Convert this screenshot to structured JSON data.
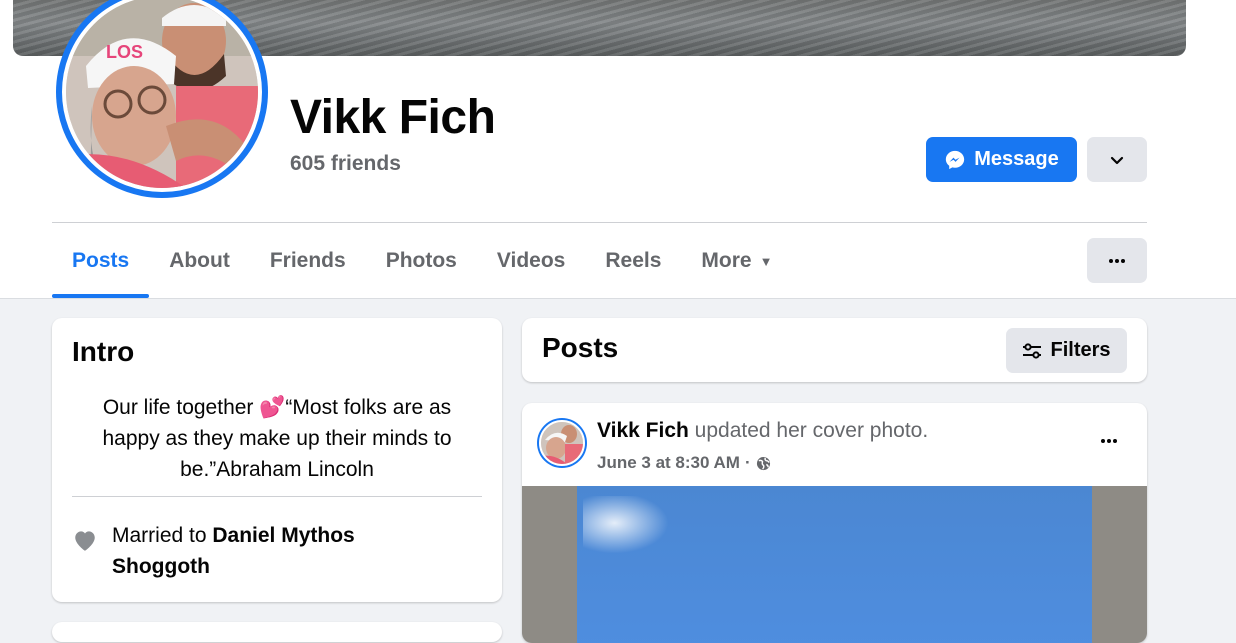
{
  "profile": {
    "name": "Vikk Fich",
    "friends": "605 friends"
  },
  "actions": {
    "message_label": "Message"
  },
  "tabs": [
    {
      "label": "Posts",
      "active": true
    },
    {
      "label": "About"
    },
    {
      "label": "Friends"
    },
    {
      "label": "Photos"
    },
    {
      "label": "Videos"
    },
    {
      "label": "Reels"
    },
    {
      "label": "More"
    }
  ],
  "intro": {
    "title": "Intro",
    "bio_before": "Our life together ",
    "bio_emoji": "💕",
    "bio_after": "“Most folks are as happy as they make up their minds to be.”Abraham Lincoln",
    "relationship_prefix": "Married to ",
    "relationship_name": "Daniel Mythos Shoggoth"
  },
  "posts_section": {
    "title": "Posts",
    "filters_label": "Filters"
  },
  "post": {
    "author": "Vikk Fich",
    "action": " updated her cover photo.",
    "timestamp": "June 3 at 8:30 AM",
    "separator": "·"
  },
  "colors": {
    "accent": "#1877f2",
    "secondary_text": "#65676b",
    "button_gray": "#e4e6eb",
    "background": "#f0f2f5"
  },
  "icons": [
    "messenger-icon",
    "chevron-down-icon",
    "caret-down-icon",
    "more-dots-icon",
    "filter-sliders-icon",
    "heart-icon",
    "globe-icon"
  ]
}
